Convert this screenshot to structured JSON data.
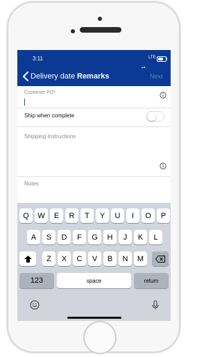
{
  "status_bar": {
    "time": "3:11",
    "network": "LTE"
  },
  "nav": {
    "back_label": "Delivery date",
    "title": "Remarks",
    "next_label": "Next"
  },
  "form": {
    "customer_po_label": "Customer PO*",
    "ship_when_complete_label": "Ship when complete",
    "shipping_instructions_label": "Shipping Instructions",
    "notes_label": "Notes"
  },
  "keyboard": {
    "row1": [
      "Q",
      "W",
      "E",
      "R",
      "T",
      "Y",
      "U",
      "I",
      "O",
      "P"
    ],
    "row2": [
      "A",
      "S",
      "D",
      "F",
      "G",
      "H",
      "J",
      "K",
      "L"
    ],
    "row3": [
      "Z",
      "X",
      "C",
      "V",
      "B",
      "N",
      "M"
    ],
    "numbers_key": "123",
    "space_key": "space",
    "return_key": "return"
  },
  "colors": {
    "nav_blue": "#0b3a95",
    "keyboard_bg": "#d1d4dc"
  }
}
